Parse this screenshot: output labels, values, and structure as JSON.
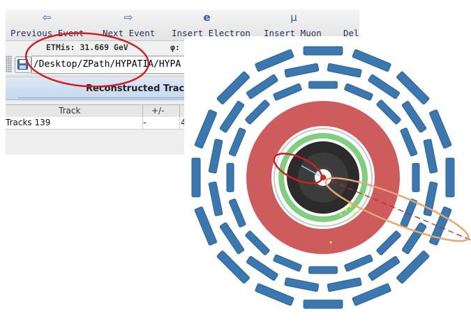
{
  "toolbar": {
    "buttons": [
      {
        "label": "Previous Event",
        "icon": "arrow-left-icon",
        "glyph": "⇦"
      },
      {
        "label": "Next Event",
        "icon": "arrow-right-icon",
        "glyph": "⇨"
      },
      {
        "label": "Insert Electron",
        "icon": "electron-icon",
        "glyph": "e"
      },
      {
        "label": "Insert Muon",
        "icon": "muon-icon",
        "glyph": "μ"
      },
      {
        "label": "Del",
        "icon": "delete-icon",
        "glyph": ""
      }
    ]
  },
  "event_info": {
    "etmis": "ETMis: 31.669 GeV",
    "phi": "φ:"
  },
  "file": {
    "path": ")/Desktop/ZPath/HYPATIA/HYPA"
  },
  "reconstructed_tracks": {
    "title": "Reconstructed Track",
    "columns": [
      "Track",
      "+/-",
      ""
    ],
    "rows": [
      {
        "track": "Tracks 139",
        "charge": "-",
        "value": "4"
      }
    ]
  },
  "colors": {
    "accent": "#2f5fa8",
    "annotation_red": "#d11f1f",
    "annotation_orange": "#e8a670",
    "calorimeter_red": "#cf5c5c",
    "inner_green": "#7fcf7f",
    "muon_chamber_blue": "#3b78b0"
  }
}
